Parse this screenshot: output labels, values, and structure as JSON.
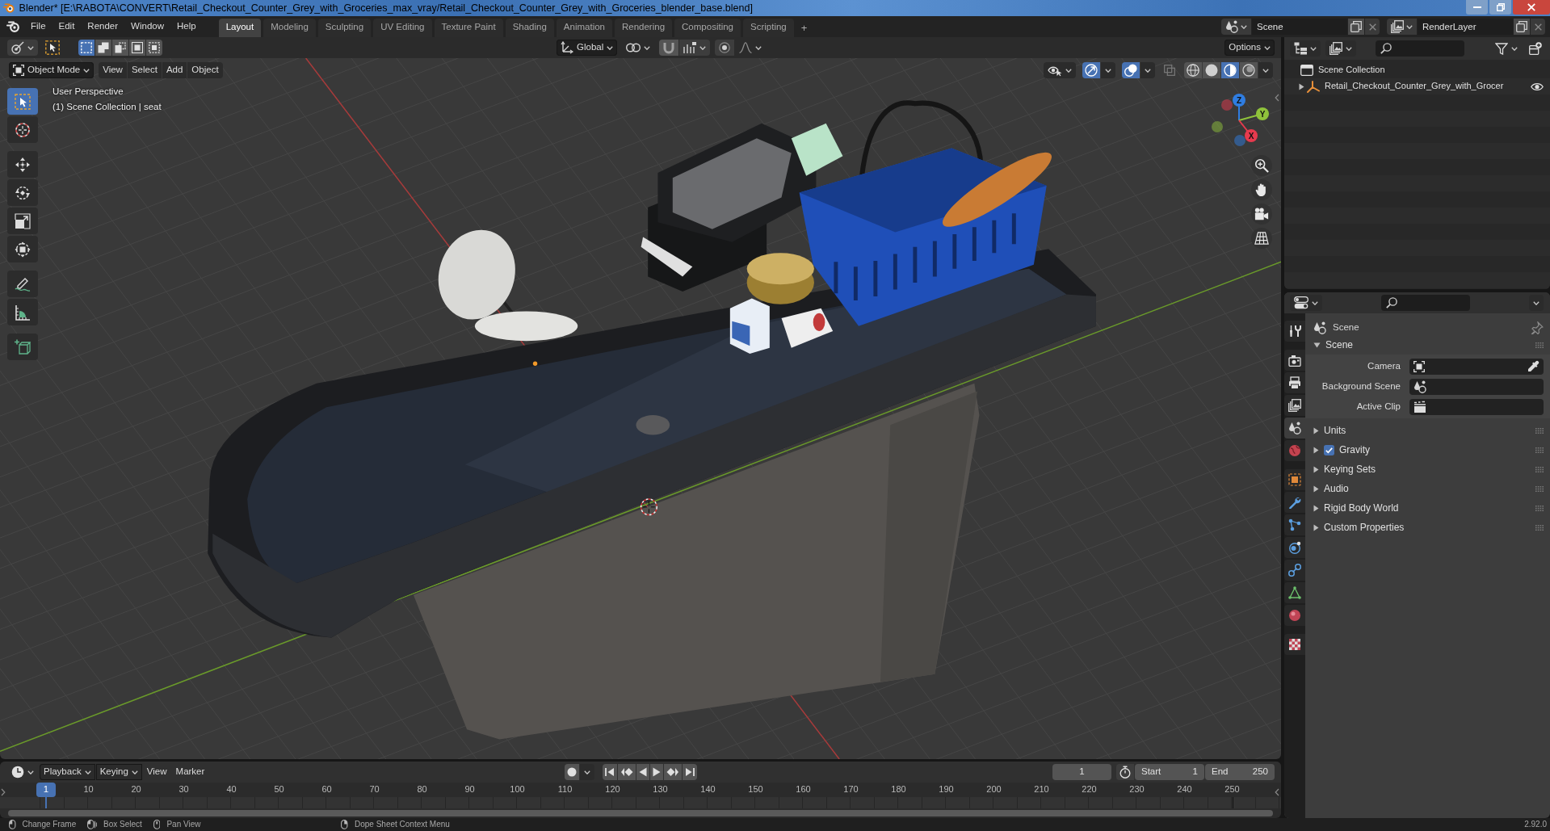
{
  "window": {
    "title": "Blender* [E:\\RABOTA\\CONVERT\\Retail_Checkout_Counter_Grey_with_Groceries_max_vray/Retail_Checkout_Counter_Grey_with_Groceries_blender_base.blend]"
  },
  "menu": [
    "File",
    "Edit",
    "Render",
    "Window",
    "Help"
  ],
  "workspaces": [
    {
      "label": "Layout",
      "selected": true
    },
    {
      "label": "Modeling",
      "selected": false
    },
    {
      "label": "Sculpting",
      "selected": false
    },
    {
      "label": "UV Editing",
      "selected": false
    },
    {
      "label": "Texture Paint",
      "selected": false
    },
    {
      "label": "Shading",
      "selected": false
    },
    {
      "label": "Animation",
      "selected": false
    },
    {
      "label": "Rendering",
      "selected": false
    },
    {
      "label": "Compositing",
      "selected": false
    },
    {
      "label": "Scripting",
      "selected": false
    }
  ],
  "add_workspace": "+",
  "scene": {
    "value": "Scene"
  },
  "view_layer": {
    "value": "RenderLayer"
  },
  "viewport": {
    "select_modes": [
      {
        "selected": true
      },
      {
        "selected": false
      },
      {
        "selected": false
      },
      {
        "selected": false
      },
      {
        "selected": false
      }
    ],
    "orientation": "Global",
    "snapping": {
      "on": false
    },
    "proportional_editing": {
      "on": false
    },
    "options": "Options",
    "mode": "Object Mode",
    "menus": [
      "View",
      "Select",
      "Add",
      "Object"
    ],
    "gizmos": {
      "on": true
    },
    "overlays": {
      "on": true
    },
    "xray": {
      "on": false
    },
    "shading": [
      {
        "kind": "wireframe",
        "selected": false
      },
      {
        "kind": "solid",
        "selected": false
      },
      {
        "kind": "material",
        "selected": true
      },
      {
        "kind": "rendered",
        "selected": false
      }
    ],
    "tools": [
      {
        "kind": "select",
        "selected": true
      },
      {
        "kind": "cursor",
        "selected": false
      },
      {
        "kind": "move",
        "selected": false
      },
      {
        "kind": "rotate",
        "selected": false
      },
      {
        "kind": "scale",
        "selected": false
      },
      {
        "kind": "transform",
        "selected": false
      },
      {
        "kind": "annotate",
        "selected": false
      },
      {
        "kind": "measure",
        "selected": false
      },
      {
        "kind": "add-cube",
        "selected": false
      }
    ],
    "info": [
      "User Perspective",
      "(1) Scene Collection | seat"
    ],
    "navigation_gizmo": [
      {
        "label": "Z",
        "color": "#2f7de1"
      },
      {
        "label": "Y",
        "color": "#8fc23b"
      },
      {
        "label": "X",
        "color": "#e63a4e"
      }
    ]
  },
  "outliner": {
    "tree": [
      {
        "label": "Scene Collection",
        "kind": "collection",
        "children": [
          {
            "label": "Retail_Checkout_Counter_Grey_with_Grocer",
            "kind": "empty",
            "expanded": false,
            "visible": true
          }
        ]
      }
    ]
  },
  "properties": {
    "tabs": [
      {
        "kind": "tool",
        "selected": false
      },
      {
        "kind": "render",
        "selected": false
      },
      {
        "kind": "output",
        "selected": false
      },
      {
        "kind": "view-layer",
        "selected": false
      },
      {
        "kind": "scene",
        "selected": true
      },
      {
        "kind": "world",
        "selected": false
      },
      {
        "kind": "object",
        "selected": false
      },
      {
        "kind": "modifiers",
        "selected": false
      },
      {
        "kind": "particles",
        "selected": false
      },
      {
        "kind": "physics",
        "selected": false
      },
      {
        "kind": "constraints",
        "selected": false
      },
      {
        "kind": "data",
        "selected": false
      },
      {
        "kind": "material",
        "selected": false
      },
      {
        "kind": "texture",
        "selected": false
      }
    ],
    "context": "Scene",
    "panels": [
      {
        "label": "Scene",
        "expanded": true,
        "fields": [
          {
            "label": "Camera",
            "kind": "camera"
          },
          {
            "label": "Background Scene",
            "kind": "scene"
          },
          {
            "label": "Active Clip",
            "kind": "clip"
          }
        ]
      },
      {
        "label": "Units",
        "expanded": false
      },
      {
        "label": "Gravity",
        "expanded": false,
        "toggle": {
          "checked": true
        }
      },
      {
        "label": "Keying Sets",
        "expanded": false
      },
      {
        "label": "Audio",
        "expanded": false
      },
      {
        "label": "Rigid Body World",
        "expanded": false
      },
      {
        "label": "Custom Properties",
        "expanded": false
      }
    ]
  },
  "timeline": {
    "menus": [
      {
        "label": "Playback",
        "kind": "dropdown"
      },
      {
        "label": "Keying",
        "kind": "dropdown"
      },
      {
        "label": "View",
        "kind": "menu"
      },
      {
        "label": "Marker",
        "kind": "menu"
      }
    ],
    "auto_keying": {
      "on": false
    },
    "current_frame": "1",
    "start": {
      "label": "Start",
      "value": "1"
    },
    "end": {
      "label": "End",
      "value": "250"
    },
    "playhead": "1",
    "ruler": [
      "10",
      "20",
      "30",
      "40",
      "50",
      "60",
      "70",
      "80",
      "90",
      "100",
      "110",
      "120",
      "130",
      "140",
      "150",
      "160",
      "170",
      "180",
      "190",
      "200",
      "210",
      "220",
      "230",
      "240",
      "250"
    ]
  },
  "status_bar": {
    "hints": [
      {
        "kind": "left-click",
        "label": "Change Frame"
      },
      {
        "kind": "drag",
        "label": "Box Select"
      },
      {
        "kind": "middle-click",
        "label": "Pan View"
      },
      {
        "kind": "right-click",
        "label": "Dope Sheet Context Menu"
      }
    ],
    "version": "2.92.0"
  }
}
